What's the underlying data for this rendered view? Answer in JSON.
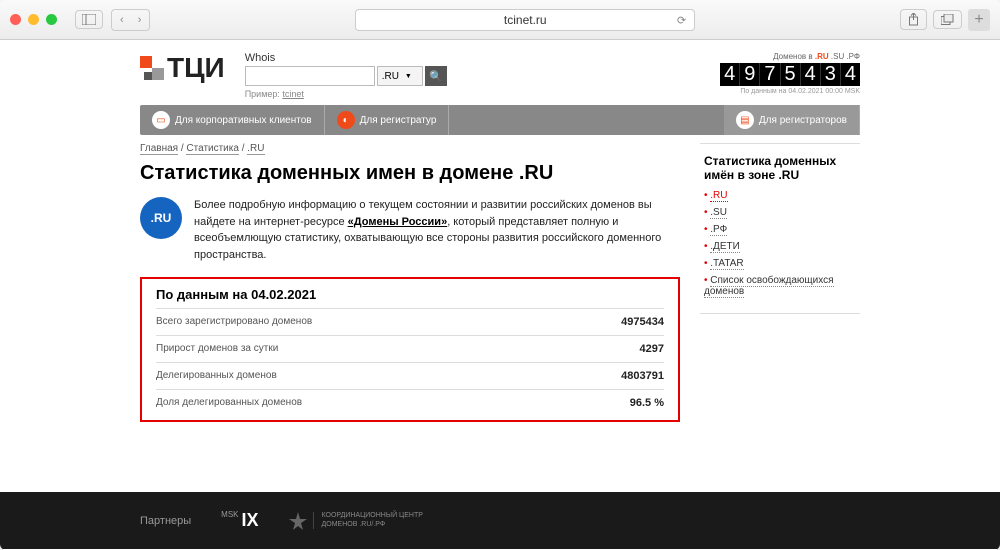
{
  "browser": {
    "url": "tcinet.ru"
  },
  "header": {
    "logo": "ТЦИ",
    "whois_label": "Whois",
    "whois_placeholder": "",
    "tld_selected": ".RU",
    "whois_hint_prefix": "Пример:",
    "whois_hint_link": "tcinet",
    "counter_caption_prefix": "Доменов в",
    "counter_caption_ru": ".RU",
    "counter_caption_rest": ".SU .РФ",
    "counter_digits": [
      "4",
      "9",
      "7",
      "5",
      "4",
      "3",
      "4"
    ],
    "counter_date": "По данным на 04.02.2021 00:00 MSK"
  },
  "nav": {
    "item1": "Для корпоративных клиентов",
    "item2": "Для регистратур",
    "item3": "Для регистраторов"
  },
  "breadcrumb": {
    "home": "Главная",
    "stat": "Статистика",
    "ru": ".RU"
  },
  "page_title": "Статистика доменных имен в домене .RU",
  "ru_badge": ".RU",
  "intro_text_1": "Более подробную информацию о текущем состоянии и развитии российских доменов вы найдете на интернет-ресурсе ",
  "intro_link": "«Домены России»",
  "intro_text_2": ", который представляет полную и всеобъемлющую статистику, охватывающую все стороны развития российского доменного пространства.",
  "statsbox": {
    "heading": "По данным на 04.02.2021",
    "rows": [
      {
        "label": "Всего зарегистрировано доменов",
        "value": "4975434"
      },
      {
        "label": "Прирост доменов за сутки",
        "value": "4297"
      },
      {
        "label": "Делегированных доменов",
        "value": "4803791"
      },
      {
        "label": "Доля делегированных доменов",
        "value": "96.5 %"
      }
    ]
  },
  "sidebar": {
    "heading": "Статистика доменных имён в зоне .RU",
    "zones": [
      ".RU",
      ".SU",
      ".РФ",
      ".ДЕТИ",
      ".TATAR"
    ],
    "releasing": "Список освобождающихся доменов"
  },
  "footer": {
    "partners": "Партнеры",
    "msk": "MSK",
    "ix": "IX",
    "coord1": "КООРДИНАЦИОННЫЙ ЦЕНТР",
    "coord2": "ДОМЕНОВ .RU/.РФ"
  }
}
